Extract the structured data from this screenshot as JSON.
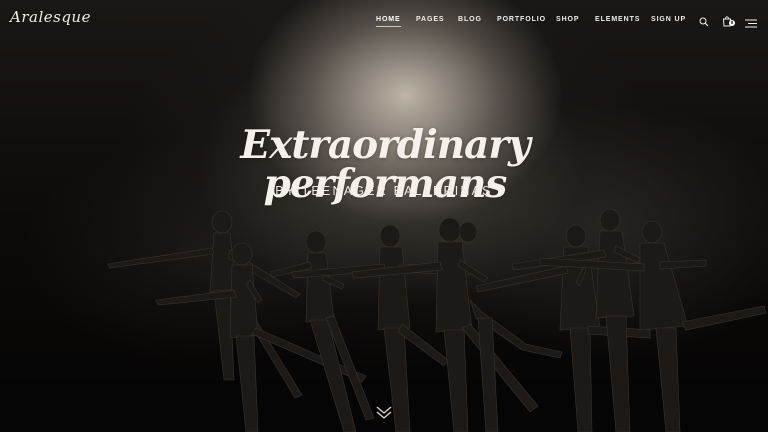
{
  "brand": {
    "logo_text": "Aralesque"
  },
  "nav": {
    "items": [
      {
        "label": "HOME",
        "active": true
      },
      {
        "label": "PAGES",
        "active": false
      },
      {
        "label": "BLOG",
        "active": false
      },
      {
        "label": "PORTFOLIO",
        "active": false
      },
      {
        "label": "SHOP",
        "active": false
      },
      {
        "label": "ELEMENTS",
        "active": false
      },
      {
        "label": "SIGN UP",
        "active": false
      }
    ],
    "icons": {
      "search": "search-icon",
      "cart": "cart-icon",
      "menu": "menu-icon"
    },
    "cart_count": "0"
  },
  "hero": {
    "headline": "Extraordinary performans",
    "subheadline": "BY TEENAGER BALLERINAS",
    "scroll_icon": "chevron-down-icon"
  },
  "colors": {
    "nav_active_underline": "#d7c7a6",
    "text": "#f5f1ea",
    "background": "#0b0a09"
  }
}
